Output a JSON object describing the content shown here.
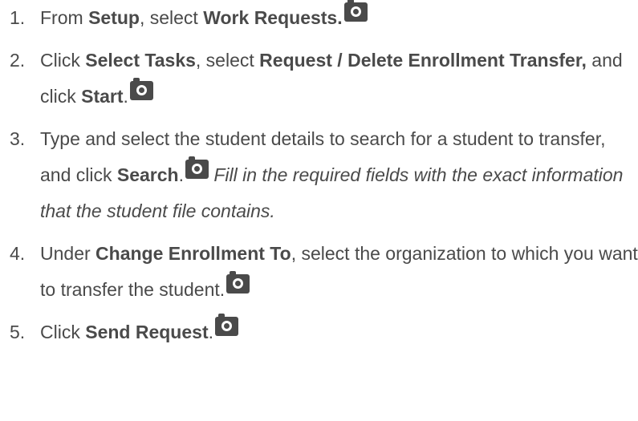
{
  "steps": [
    {
      "number": "1.",
      "t1": "From ",
      "b1": "Setup",
      "t2": ", select ",
      "b2": "Work Requests.",
      "icon": "camera-icon"
    },
    {
      "number": "2.",
      "t1": "Click ",
      "b1": "Select Tasks",
      "t2": ", select ",
      "b2": "Request / Delete Enrollment Transfer,",
      "t3": " and click ",
      "b3": "Start",
      "t4": ".",
      "icon": "camera-icon"
    },
    {
      "number": "3.",
      "t1": "Type and select the student details to search for a student to transfer, and click ",
      "b1": "Search",
      "t2": ".",
      "icon": "camera-icon",
      "note": "Fill in the required fields with the exact information that the student file contains."
    },
    {
      "number": "4.",
      "t1": "Under ",
      "b1": "Change Enrollment To",
      "t2": ", select the organization to which you want to transfer the student.",
      "icon": "camera-icon"
    },
    {
      "number": "5.",
      "t1": "Click ",
      "b1": "Send Request",
      "t2": ".",
      "icon": "camera-icon"
    }
  ],
  "colors": {
    "text": "#4a4a4a",
    "background": "#ffffff"
  }
}
